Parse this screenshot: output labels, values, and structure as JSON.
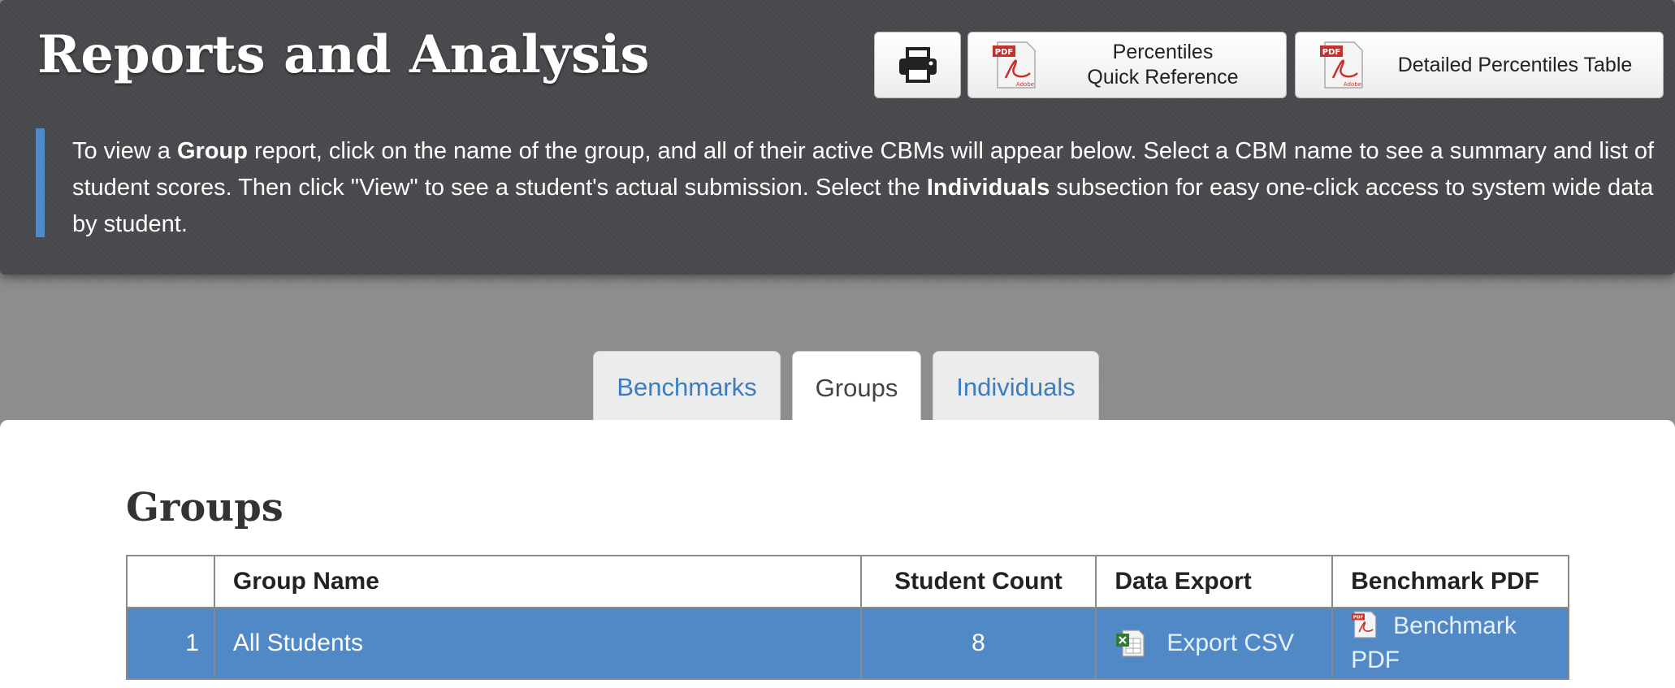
{
  "header": {
    "title": "Reports and Analysis",
    "buttons": {
      "print_icon": "printer-icon",
      "percentiles_line1": "Percentiles",
      "percentiles_line2": "Quick Reference",
      "detailed": "Detailed Percentiles Table"
    },
    "info": {
      "p1": "To view a ",
      "b1": "Group",
      "p2": " report, click on the name of the group, and all of their active CBMs will appear below. Select a CBM name to see a summary and list of student scores. Then click \"View\" to see a student's actual submission. Select the ",
      "b2": "Individuals",
      "p3": " subsection for easy one-click access to system wide data by student."
    }
  },
  "tabs": [
    {
      "label": "Benchmarks",
      "active": false
    },
    {
      "label": "Groups",
      "active": true
    },
    {
      "label": "Individuals",
      "active": false
    }
  ],
  "main": {
    "heading": "Groups",
    "columns": [
      "",
      "Group Name",
      "Student Count",
      "Data Export",
      "Benchmark PDF"
    ],
    "rows": [
      {
        "num": "1",
        "name": "All Students",
        "count": "8",
        "export": "Export CSV",
        "pdf": "Benchmark PDF",
        "selected": true
      }
    ]
  },
  "colors": {
    "header_bg": "#48494c",
    "accent": "#4f8bc9",
    "selected_row": "#5089c6",
    "tab_link": "#3b7dc0"
  }
}
